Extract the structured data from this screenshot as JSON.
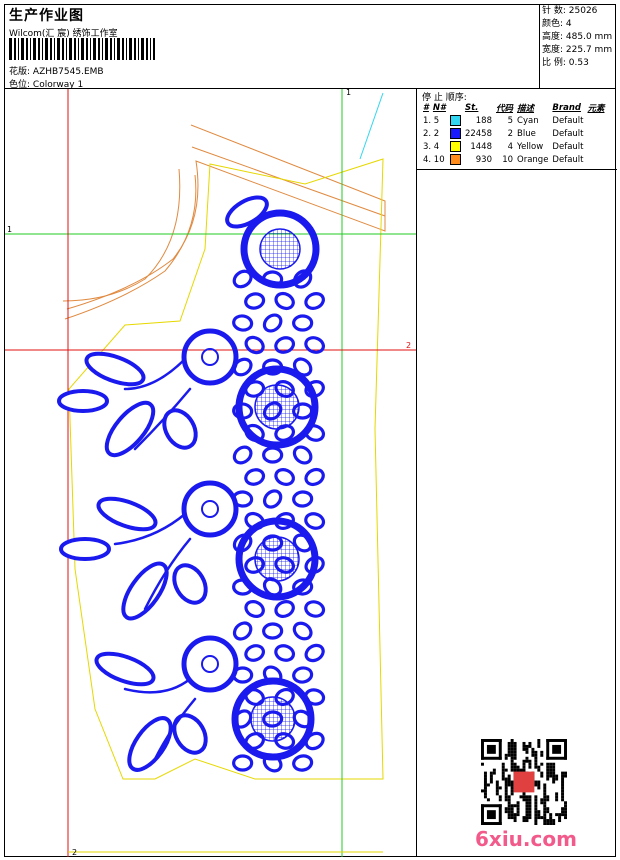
{
  "header": {
    "title": "生产作业图",
    "studio": "Wilcom(汇 宸) 绣饰工作室",
    "design_label": "花版:",
    "design_value": "AZHB7545.EMB",
    "colorway_label": "色位:",
    "colorway_value": "Colorway 1"
  },
  "stats": {
    "stitches_label": "针 数:",
    "stitches_value": "25026",
    "colors_label": "颜色:",
    "colors_value": "4",
    "height_label": "高度:",
    "height_value": "485.0 mm",
    "width_label": "宽度:",
    "width_value": "225.7 mm",
    "scale_label": "比 例:",
    "scale_value": "0.53"
  },
  "stop_sequence": {
    "title": "停 止 顺序:",
    "columns": [
      "#",
      "N#",
      "St.",
      "代码",
      "描述",
      "Brand",
      "元素"
    ],
    "rows": [
      {
        "idx": "1. 5",
        "swatch": "#33d6f0",
        "st": "188",
        "code": "5",
        "desc": "Cyan",
        "brand": "Default"
      },
      {
        "idx": "2. 2",
        "swatch": "#1a1aff",
        "st": "22458",
        "code": "2",
        "desc": "Blue",
        "brand": "Default"
      },
      {
        "idx": "3. 4",
        "swatch": "#ffff00",
        "st": "1448",
        "code": "4",
        "desc": "Yellow",
        "brand": "Default"
      },
      {
        "idx": "4. 10",
        "swatch": "#ff8c1a",
        "st": "930",
        "code": "10",
        "desc": "Orange",
        "brand": "Default"
      }
    ]
  },
  "guides": {
    "green_top": "1",
    "green_left": "1",
    "red_right": "2",
    "red_bottom": "2"
  },
  "watermark": "6xiu.com",
  "colors": {
    "embroidery": "#1a1aee",
    "outline_yellow": "#e6d800",
    "outline_orange": "#e08a40",
    "guide_green": "#22cc22",
    "guide_red": "#e01010",
    "cyan": "#33d6f0"
  }
}
